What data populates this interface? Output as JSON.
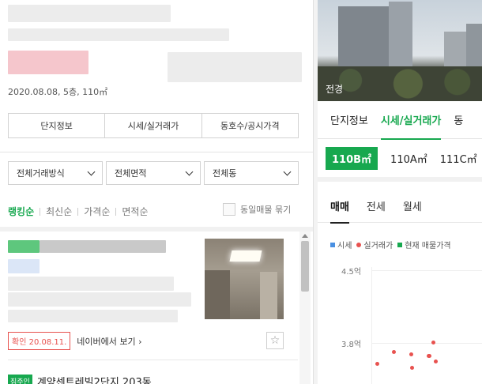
{
  "left": {
    "deal_info": "2020.08.08, 5층, 110㎡",
    "tabs": [
      "단지정보",
      "시세/실거래가",
      "동호수/공시가격"
    ],
    "filters": [
      "전체거래방식",
      "전체면적",
      "전체동"
    ],
    "sort": [
      "랭킹순",
      "최신순",
      "가격순",
      "면적순"
    ],
    "same_listing_toggle": "동일매물 묶기",
    "listing": {
      "confirm_badge": "확인 20.08.11.",
      "naver_link": "네이버에서 보기 ›",
      "favorite_icon": "star-icon"
    },
    "next_listing": {
      "tag": "집주인",
      "name": "계양센트레빌2단지 203동"
    }
  },
  "right": {
    "photo_label": "전경",
    "tabs": [
      "단지정보",
      "시세/실거래가",
      "동"
    ],
    "areas": [
      "110B㎡",
      "110A㎡",
      "111C㎡"
    ],
    "deal_tabs": [
      "매매",
      "전세",
      "월세"
    ],
    "legend": [
      {
        "label": "시세",
        "color": "#4a90e2",
        "shape": "square"
      },
      {
        "label": "실거래가",
        "color": "#e8524f",
        "shape": "dot"
      },
      {
        "label": "현재 매물가격",
        "color": "#17a84f",
        "shape": "square"
      }
    ],
    "chart_data": {
      "type": "scatter",
      "ylim": [
        3.5,
        4.6
      ],
      "yticks": [
        "4.5억",
        "3.8억"
      ],
      "series": [
        {
          "name": "실거래가",
          "color": "#e8524f",
          "points": [
            3.82,
            3.73,
            3.69,
            3.71,
            3.69,
            3.64,
            3.62,
            3.58
          ]
        }
      ]
    }
  },
  "colors": {
    "accent": "#17a84f",
    "alert": "#e8524f"
  }
}
